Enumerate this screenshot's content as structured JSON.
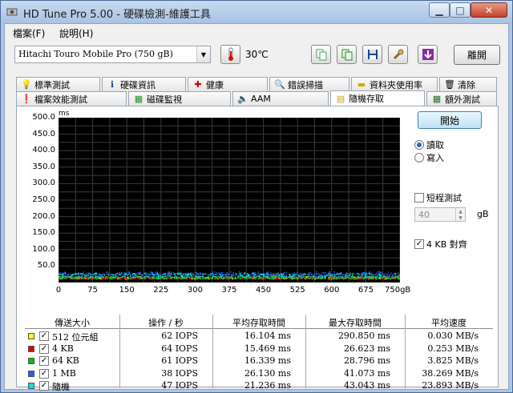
{
  "window": {
    "title": "HD Tune Pro  5.00 - 硬碟檢測-維護工具"
  },
  "menu": {
    "file": "檔案(F)",
    "help": "說明(H)"
  },
  "toolbar": {
    "drive": "Hitachi Touro Mobile Pro (750 gB)",
    "temperature": "30℃",
    "exit": "離開"
  },
  "tabs_row1": [
    "標準測試",
    "硬碟資訊",
    "健康",
    "錯誤掃描",
    "資料夾使用率",
    "清除"
  ],
  "tabs_row2": [
    "檔案效能測試",
    "磁碟監視",
    "AAM",
    "隨機存取",
    "額外測試"
  ],
  "active_tab": "隨機存取",
  "side": {
    "start": "開始",
    "read": "讀取",
    "write": "寫入",
    "short_test": "短程測試",
    "short_value": "40",
    "short_unit": "gB",
    "align": "4 KB 對齊"
  },
  "chart_data": {
    "type": "scatter",
    "ylabel": "ms",
    "y_ticks": [
      "500.0",
      "450.0",
      "400.0",
      "350.0",
      "300.0",
      "250.0",
      "200.0",
      "150.0",
      "100.0",
      "50.0"
    ],
    "x_ticks": [
      "0",
      "75",
      "150",
      "225",
      "300",
      "375",
      "450",
      "525",
      "600",
      "675",
      "750gB"
    ],
    "ylim": [
      0,
      500
    ],
    "xlim": [
      0,
      750
    ],
    "grid": true,
    "series": [
      {
        "color": "#e6e600",
        "typical_ms": [
          12,
          20
        ],
        "outliers_ms": [
          290.85
        ]
      },
      {
        "color": "#e00000",
        "typical_ms": [
          12,
          18
        ]
      },
      {
        "color": "#00c000",
        "typical_ms": [
          12,
          20
        ]
      },
      {
        "color": "#2060ff",
        "typical_ms": [
          18,
          34
        ]
      },
      {
        "color": "#00e0e0",
        "typical_ms": [
          15,
          30
        ]
      }
    ]
  },
  "results": {
    "headers": [
      "傳送大小",
      "操作 / 秒",
      "平均存取時間",
      "最大存取時間",
      "平均速度"
    ],
    "rows": [
      {
        "color": "#ffff00",
        "checked": true,
        "size": "512 位元組",
        "ops": "62 IOPS",
        "avg": "16.104 ms",
        "max": "290.850 ms",
        "speed": "0.030 MB/s"
      },
      {
        "color": "#e00000",
        "checked": true,
        "size": "4 KB",
        "ops": "64 IOPS",
        "avg": "15.469 ms",
        "max": "26.623 ms",
        "speed": "0.253 MB/s"
      },
      {
        "color": "#00c000",
        "checked": true,
        "size": "64 KB",
        "ops": "61 IOPS",
        "avg": "16.339 ms",
        "max": "28.796 ms",
        "speed": "3.825 MB/s"
      },
      {
        "color": "#2060ff",
        "checked": true,
        "size": "1 MB",
        "ops": "38 IOPS",
        "avg": "26.130 ms",
        "max": "41.073 ms",
        "speed": "38.269 MB/s"
      },
      {
        "color": "#00e0e0",
        "checked": true,
        "size": "隨機",
        "ops": "47 IOPS",
        "avg": "21.236 ms",
        "max": "43.043 ms",
        "speed": "23.893 MB/s"
      }
    ]
  }
}
